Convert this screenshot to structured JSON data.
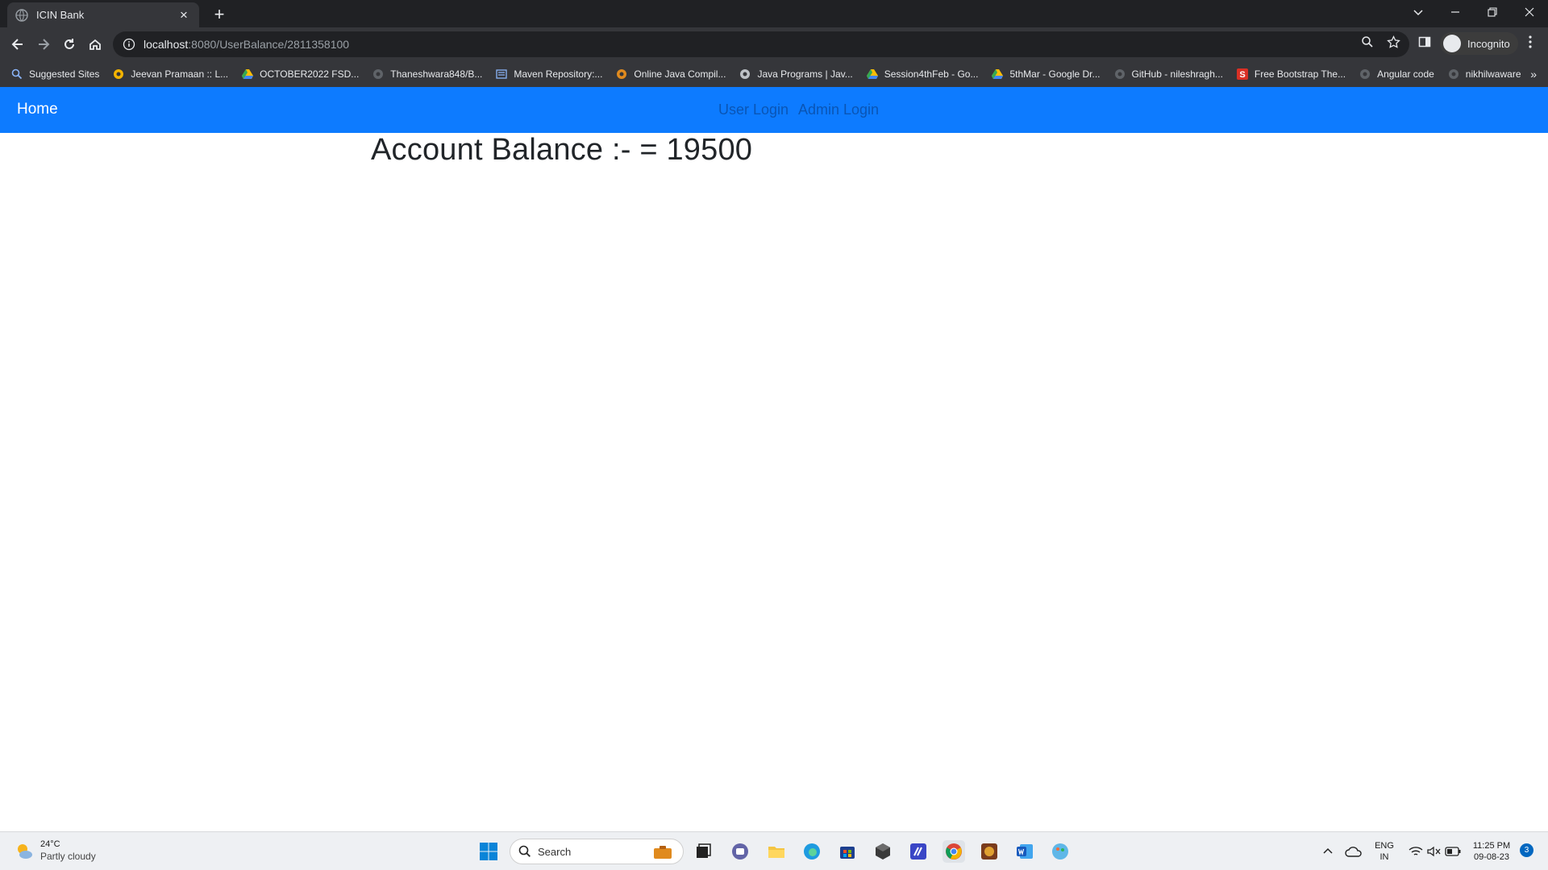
{
  "browser": {
    "tab_title": "ICIN Bank",
    "url_host": "localhost",
    "url_path": ":8080/UserBalance/2811358100",
    "profile_label": "Incognito",
    "bookmarks": [
      {
        "label": "Suggested Sites",
        "icon": "search-icon"
      },
      {
        "label": "Jeevan Pramaan :: L...",
        "icon": "site-icon"
      },
      {
        "label": "OCTOBER2022 FSD...",
        "icon": "drive-icon"
      },
      {
        "label": "Thaneshwara848/B...",
        "icon": "github-icon"
      },
      {
        "label": "Maven Repository:...",
        "icon": "maven-icon"
      },
      {
        "label": "Online Java Compil...",
        "icon": "compiler-icon"
      },
      {
        "label": "Java Programs | Jav...",
        "icon": "globe-icon"
      },
      {
        "label": "Session4thFeb - Go...",
        "icon": "drive-icon"
      },
      {
        "label": "5thMar - Google Dr...",
        "icon": "drive-icon"
      },
      {
        "label": "GitHub - nileshragh...",
        "icon": "github-icon"
      },
      {
        "label": "Free Bootstrap The...",
        "icon": "s-icon"
      },
      {
        "label": "Angular code",
        "icon": "github-icon"
      },
      {
        "label": "nikhilwaware",
        "icon": "github-icon"
      }
    ]
  },
  "page": {
    "nav_home": "Home",
    "nav_user_login": "User Login",
    "nav_admin_login": "Admin Login",
    "balance_text": "Account Balance :- = 19500"
  },
  "taskbar": {
    "weather_temp": "24°C",
    "weather_condition": "Partly cloudy",
    "search_label": "Search",
    "lang_line1": "ENG",
    "lang_line2": "IN",
    "time": "11:25 PM",
    "date": "09-08-23",
    "notification_count": "3"
  },
  "colors": {
    "navbar_bg": "#0d7bff",
    "chrome_dark": "#202124",
    "chrome_toolbar": "#35363a"
  }
}
